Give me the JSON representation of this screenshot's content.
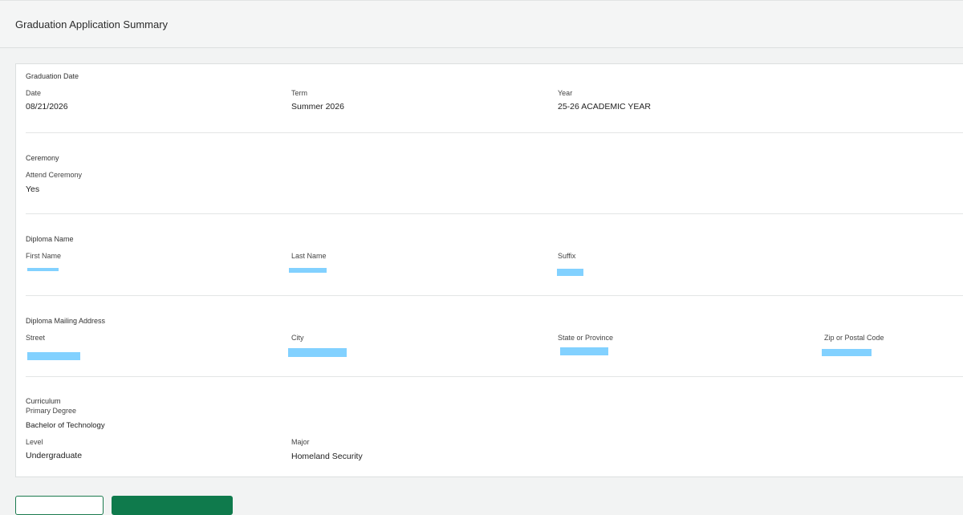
{
  "header": {
    "title": "Graduation Application Summary"
  },
  "graduation_date": {
    "section_title": "Graduation Date",
    "date_label": "Date",
    "date_value": "08/21/2026",
    "term_label": "Term",
    "term_value": "Summer 2026",
    "year_label": "Year",
    "year_value": "25-26 ACADEMIC YEAR"
  },
  "ceremony": {
    "section_title": "Ceremony",
    "attend_label": "Attend Ceremony",
    "attend_value": "Yes"
  },
  "diploma_name": {
    "section_title": "Diploma Name",
    "first_label": "First Name",
    "last_label": "Last Name",
    "suffix_label": "Suffix"
  },
  "mailing_address": {
    "section_title": "Diploma Mailing Address",
    "street_label": "Street",
    "city_label": "City",
    "state_label": "State or Province",
    "zip_label": "Zip or Postal Code"
  },
  "curriculum": {
    "section_title": "Curriculum",
    "primary_label": "Primary Degree",
    "degree_value": "Bachelor of Technology",
    "level_label": "Level",
    "level_value": "Undergraduate",
    "major_label": "Major",
    "major_value": "Homeland Security"
  },
  "colors": {
    "primary_button": "#0f7a4c",
    "redaction": "#82d1ff"
  }
}
